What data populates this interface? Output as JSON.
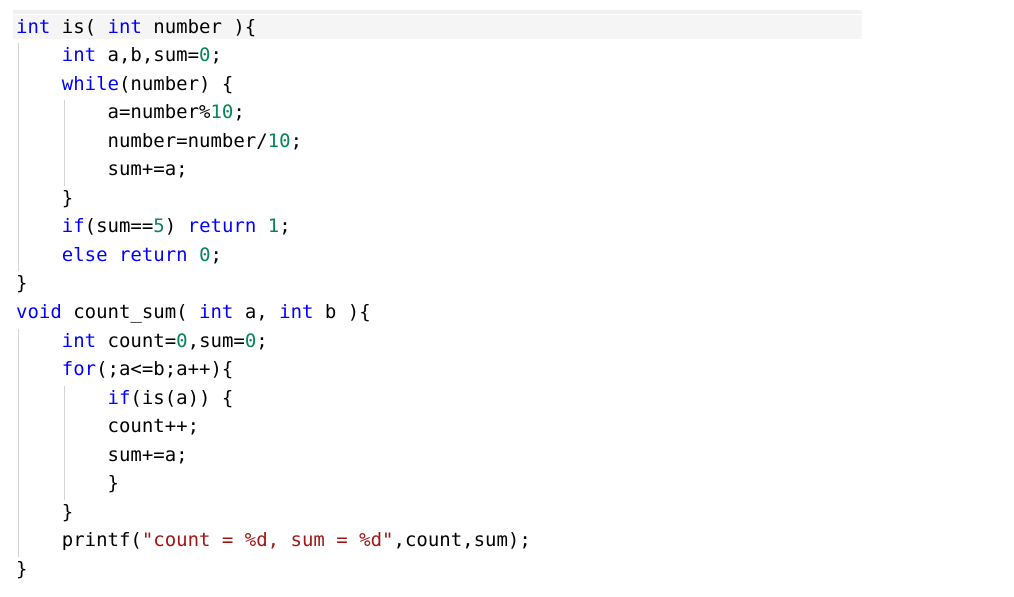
{
  "colors": {
    "keyword": "#0000ff",
    "number": "#098658",
    "string": "#a31515",
    "text": "#000000",
    "background": "#ffffff",
    "indent_guide": "#d4d4d4"
  },
  "code_lines": [
    {
      "indent": "",
      "tokens": [
        {
          "t": "kw",
          "v": "int"
        },
        {
          "t": "text",
          "v": " is( "
        },
        {
          "t": "kw",
          "v": "int"
        },
        {
          "t": "text",
          "v": " number ){"
        }
      ]
    },
    {
      "indent": "    ",
      "tokens": [
        {
          "t": "kw",
          "v": "int"
        },
        {
          "t": "text",
          "v": " a,b,sum="
        },
        {
          "t": "num",
          "v": "0"
        },
        {
          "t": "text",
          "v": ";"
        }
      ]
    },
    {
      "indent": "    ",
      "tokens": [
        {
          "t": "kw",
          "v": "while"
        },
        {
          "t": "text",
          "v": "(number) {"
        }
      ]
    },
    {
      "indent": "        ",
      "tokens": [
        {
          "t": "text",
          "v": "a=number%"
        },
        {
          "t": "num",
          "v": "10"
        },
        {
          "t": "text",
          "v": ";"
        }
      ]
    },
    {
      "indent": "        ",
      "tokens": [
        {
          "t": "text",
          "v": "number=number/"
        },
        {
          "t": "num",
          "v": "10"
        },
        {
          "t": "text",
          "v": ";"
        }
      ]
    },
    {
      "indent": "        ",
      "tokens": [
        {
          "t": "text",
          "v": "sum+=a;"
        }
      ]
    },
    {
      "indent": "    ",
      "tokens": [
        {
          "t": "text",
          "v": "}"
        }
      ]
    },
    {
      "indent": "    ",
      "tokens": [
        {
          "t": "kw",
          "v": "if"
        },
        {
          "t": "text",
          "v": "(sum=="
        },
        {
          "t": "num",
          "v": "5"
        },
        {
          "t": "text",
          "v": ") "
        },
        {
          "t": "kw",
          "v": "return"
        },
        {
          "t": "text",
          "v": " "
        },
        {
          "t": "num",
          "v": "1"
        },
        {
          "t": "text",
          "v": ";"
        }
      ]
    },
    {
      "indent": "    ",
      "tokens": [
        {
          "t": "kw",
          "v": "else"
        },
        {
          "t": "text",
          "v": " "
        },
        {
          "t": "kw",
          "v": "return"
        },
        {
          "t": "text",
          "v": " "
        },
        {
          "t": "num",
          "v": "0"
        },
        {
          "t": "text",
          "v": ";"
        }
      ]
    },
    {
      "indent": "",
      "tokens": [
        {
          "t": "text",
          "v": "}"
        }
      ]
    },
    {
      "indent": "",
      "tokens": [
        {
          "t": "kw",
          "v": "void"
        },
        {
          "t": "text",
          "v": " count_sum( "
        },
        {
          "t": "kw",
          "v": "int"
        },
        {
          "t": "text",
          "v": " a, "
        },
        {
          "t": "kw",
          "v": "int"
        },
        {
          "t": "text",
          "v": " b ){"
        }
      ]
    },
    {
      "indent": "    ",
      "tokens": [
        {
          "t": "kw",
          "v": "int"
        },
        {
          "t": "text",
          "v": " count="
        },
        {
          "t": "num",
          "v": "0"
        },
        {
          "t": "text",
          "v": ",sum="
        },
        {
          "t": "num",
          "v": "0"
        },
        {
          "t": "text",
          "v": ";"
        }
      ]
    },
    {
      "indent": "    ",
      "tokens": [
        {
          "t": "kw",
          "v": "for"
        },
        {
          "t": "text",
          "v": "(;a<=b;a++){"
        }
      ]
    },
    {
      "indent": "        ",
      "tokens": [
        {
          "t": "kw",
          "v": "if"
        },
        {
          "t": "text",
          "v": "(is(a)) {"
        }
      ]
    },
    {
      "indent": "        ",
      "tokens": [
        {
          "t": "text",
          "v": "count++;"
        }
      ]
    },
    {
      "indent": "        ",
      "tokens": [
        {
          "t": "text",
          "v": "sum+=a;"
        }
      ]
    },
    {
      "indent": "        ",
      "tokens": [
        {
          "t": "text",
          "v": "}"
        }
      ]
    },
    {
      "indent": "    ",
      "tokens": [
        {
          "t": "text",
          "v": "}"
        }
      ]
    },
    {
      "indent": "    ",
      "tokens": [
        {
          "t": "text",
          "v": "printf("
        },
        {
          "t": "str",
          "v": "\"count = %d, sum = %d\""
        },
        {
          "t": "text",
          "v": ",count,sum);"
        }
      ]
    },
    {
      "indent": "",
      "tokens": [
        {
          "t": "text",
          "v": "}"
        }
      ]
    }
  ]
}
